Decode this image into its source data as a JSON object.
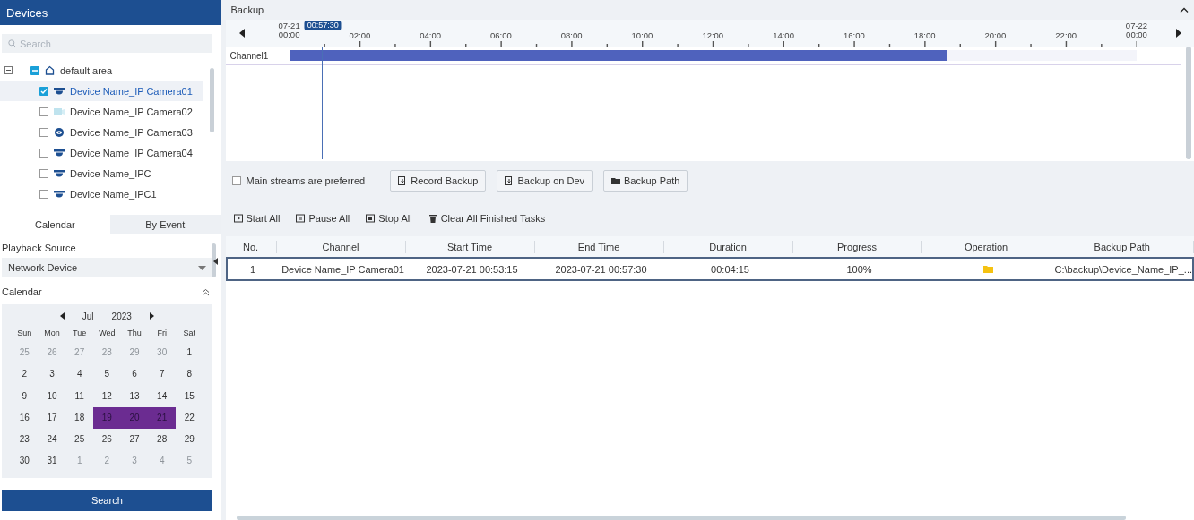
{
  "devices": {
    "title": "Devices",
    "search": {
      "placeholder": "Search"
    },
    "tree": {
      "label": "default area",
      "expanded": true,
      "partial": true,
      "children": [
        {
          "label": "Device Name_IP Camera01",
          "kind": "dome",
          "checked": true,
          "selected": true
        },
        {
          "label": "Device Name_IP Camera02",
          "kind": "bullet",
          "checked": false,
          "selected": false
        },
        {
          "label": "Device Name_IP Camera03",
          "kind": "fisheye",
          "checked": false,
          "selected": false
        },
        {
          "label": "Device Name_IP Camera04",
          "kind": "dome",
          "checked": false,
          "selected": false
        },
        {
          "label": "Device Name_IPC",
          "kind": "dome",
          "checked": false,
          "selected": false
        },
        {
          "label": "Device Name_IPC1",
          "kind": "dome",
          "checked": false,
          "selected": false
        }
      ]
    }
  },
  "tabs": [
    {
      "label": "Calendar",
      "selected": true
    },
    {
      "label": "By Event",
      "selected": false
    }
  ],
  "playback_source": {
    "label": "Playback Source",
    "value": "Network Device"
  },
  "calendar": {
    "label": "Calendar",
    "month": "Jul",
    "year": "2023",
    "weekdays": [
      "Sun",
      "Mon",
      "Tue",
      "Wed",
      "Thu",
      "Fri",
      "Sat"
    ],
    "days": [
      {
        "label": "25",
        "other_month": true,
        "selected": false
      },
      {
        "label": "26",
        "other_month": true,
        "selected": false
      },
      {
        "label": "27",
        "other_month": true,
        "selected": false
      },
      {
        "label": "28",
        "other_month": true,
        "selected": false
      },
      {
        "label": "29",
        "other_month": true,
        "selected": false
      },
      {
        "label": "30",
        "other_month": true,
        "selected": false
      },
      {
        "label": "1",
        "other_month": false,
        "selected": false
      },
      {
        "label": "2",
        "other_month": false,
        "selected": false
      },
      {
        "label": "3",
        "other_month": false,
        "selected": false
      },
      {
        "label": "4",
        "other_month": false,
        "selected": false
      },
      {
        "label": "5",
        "other_month": false,
        "selected": false
      },
      {
        "label": "6",
        "other_month": false,
        "selected": false
      },
      {
        "label": "7",
        "other_month": false,
        "selected": false
      },
      {
        "label": "8",
        "other_month": false,
        "selected": false
      },
      {
        "label": "9",
        "other_month": false,
        "selected": false
      },
      {
        "label": "10",
        "other_month": false,
        "selected": false
      },
      {
        "label": "11",
        "other_month": false,
        "selected": false
      },
      {
        "label": "12",
        "other_month": false,
        "selected": false
      },
      {
        "label": "13",
        "other_month": false,
        "selected": false
      },
      {
        "label": "14",
        "other_month": false,
        "selected": false
      },
      {
        "label": "15",
        "other_month": false,
        "selected": false
      },
      {
        "label": "16",
        "other_month": false,
        "selected": false
      },
      {
        "label": "17",
        "other_month": false,
        "selected": false
      },
      {
        "label": "18",
        "other_month": false,
        "selected": false
      },
      {
        "label": "19",
        "other_month": false,
        "selected": true
      },
      {
        "label": "20",
        "other_month": false,
        "selected": true
      },
      {
        "label": "21",
        "other_month": false,
        "selected": true
      },
      {
        "label": "22",
        "other_month": false,
        "selected": false
      },
      {
        "label": "23",
        "other_month": false,
        "selected": false
      },
      {
        "label": "24",
        "other_month": false,
        "selected": false
      },
      {
        "label": "25",
        "other_month": false,
        "selected": false
      },
      {
        "label": "26",
        "other_month": false,
        "selected": false
      },
      {
        "label": "27",
        "other_month": false,
        "selected": false
      },
      {
        "label": "28",
        "other_month": false,
        "selected": false
      },
      {
        "label": "29",
        "other_month": false,
        "selected": false
      },
      {
        "label": "30",
        "other_month": false,
        "selected": false
      },
      {
        "label": "31",
        "other_month": false,
        "selected": false
      },
      {
        "label": "1",
        "other_month": true,
        "selected": false
      },
      {
        "label": "2",
        "other_month": true,
        "selected": false
      },
      {
        "label": "3",
        "other_month": true,
        "selected": false
      },
      {
        "label": "4",
        "other_month": true,
        "selected": false
      },
      {
        "label": "5",
        "other_month": true,
        "selected": false
      }
    ]
  },
  "search_button": "Search",
  "backup": {
    "title": "Backup",
    "timeline": {
      "cursor": {
        "time": "00:57:30",
        "level": 0.04
      },
      "ticks": [
        {
          "date": "07-21",
          "time": "00:00"
        },
        {
          "time": "02:00"
        },
        {
          "time": "04:00"
        },
        {
          "time": "06:00"
        },
        {
          "time": "08:00"
        },
        {
          "time": "10:00"
        },
        {
          "time": "12:00"
        },
        {
          "time": "14:00"
        },
        {
          "time": "16:00"
        },
        {
          "time": "18:00"
        },
        {
          "time": "20:00"
        },
        {
          "time": "22:00"
        },
        {
          "date": "07-22",
          "time": "00:00"
        }
      ],
      "channels": [
        {
          "name": "Channel1",
          "level": 0.776
        }
      ]
    },
    "main_streams": {
      "label": "Main streams are preferred",
      "checked": false
    },
    "buttons": [
      {
        "label": "Record Backup",
        "kind": "record"
      },
      {
        "label": "Backup on Dev",
        "kind": "record"
      },
      {
        "label": "Backup Path",
        "kind": "folder"
      }
    ],
    "actions": [
      {
        "label": "Start All",
        "kind": "start"
      },
      {
        "label": "Pause All",
        "kind": "pause"
      },
      {
        "label": "Stop All",
        "kind": "stop"
      },
      {
        "label": "Clear All Finished Tasks",
        "kind": "clear"
      }
    ],
    "table": {
      "columns": [
        "No.",
        "Channel",
        "Start Time",
        "End Time",
        "Duration",
        "Progress",
        "Operation",
        "Backup Path"
      ],
      "rows": [
        {
          "selected": true,
          "cells": [
            "1",
            "Device Name_IP Camera01",
            "2023-07-21 00:53:15",
            "2023-07-21 00:57:30",
            "00:04:15",
            "100%",
            {
              "kind": "folder"
            },
            "C:\\backup\\Device_Name_IP_..."
          ]
        }
      ]
    }
  }
}
